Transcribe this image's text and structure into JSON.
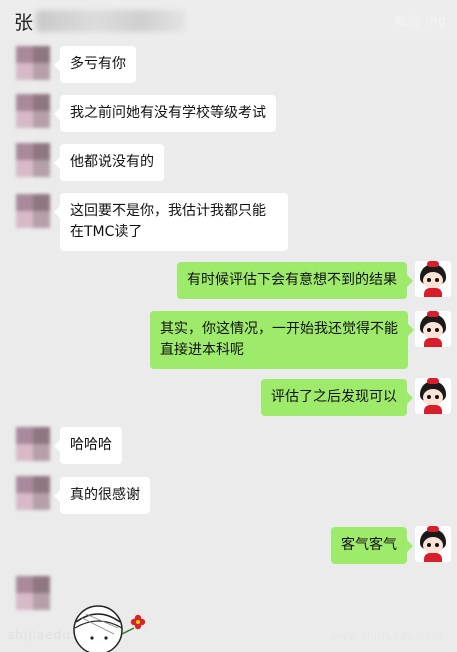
{
  "header": {
    "title_char": "张",
    "watermark_top": "微信 ing"
  },
  "messages": [
    {
      "side": "left",
      "text": "多亏有你"
    },
    {
      "side": "left",
      "text": "我之前问她有没有学校等级考试"
    },
    {
      "side": "left",
      "text": "他都说没有的"
    },
    {
      "side": "left",
      "text": "这回要不是你，我估计我都只能在TMC读了"
    },
    {
      "side": "right",
      "text": "有时候评估下会有意想不到的结果"
    },
    {
      "side": "right",
      "text": "其实，你这情况，一开始我还觉得不能直接进本科呢"
    },
    {
      "side": "right",
      "text": "评估了之后发现可以"
    },
    {
      "side": "left",
      "text": "哈哈哈"
    },
    {
      "side": "left",
      "text": "真的很感谢"
    },
    {
      "side": "right",
      "text": "客气客气"
    }
  ],
  "footer": {
    "watermark_left": "shijiaedu",
    "watermark_right": "www.shijiaedu.com"
  },
  "colors": {
    "background": "#ebebeb",
    "bubble_left": "#ffffff",
    "bubble_right": "#9eea6a"
  },
  "icons": {
    "my_avatar": "cartoon-doll-avatar",
    "contact_avatar": "blurred-avatar",
    "sticker": "bandaged-head-sticker"
  }
}
